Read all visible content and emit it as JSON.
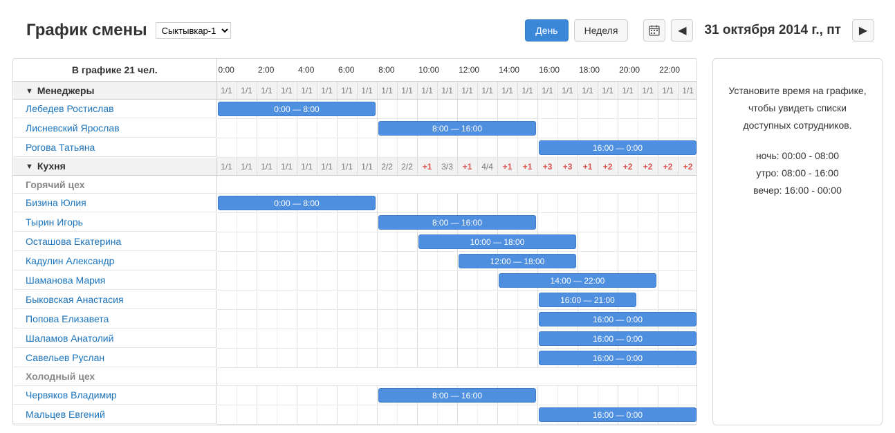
{
  "header": {
    "title": "График смены",
    "location": "Сыктывкар-1",
    "day_btn": "День",
    "week_btn": "Неделя",
    "date": "31 октября 2014 г., пт"
  },
  "side": {
    "hint": "Установите время на графике, чтобы увидеть списки доступных сотрудников.",
    "night": "ночь: 00:00 - 08:00",
    "morning": "утро: 08:00 - 16:00",
    "evening": "вечер: 16:00 - 00:00"
  },
  "top": {
    "count_label": "В графике 21 чел.",
    "hours": [
      "0:00",
      "",
      "2:00",
      "",
      "4:00",
      "",
      "6:00",
      "",
      "8:00",
      "",
      "10:00",
      "",
      "12:00",
      "",
      "14:00",
      "",
      "16:00",
      "",
      "18:00",
      "",
      "20:00",
      "",
      "22:00",
      ""
    ]
  },
  "groups": [
    {
      "name": "Менеджеры",
      "collapsible": true,
      "hours": [
        {
          "v": "1/1"
        },
        {
          "v": "1/1"
        },
        {
          "v": "1/1"
        },
        {
          "v": "1/1"
        },
        {
          "v": "1/1"
        },
        {
          "v": "1/1"
        },
        {
          "v": "1/1"
        },
        {
          "v": "1/1"
        },
        {
          "v": "1/1"
        },
        {
          "v": "1/1"
        },
        {
          "v": "1/1"
        },
        {
          "v": "1/1"
        },
        {
          "v": "1/1"
        },
        {
          "v": "1/1"
        },
        {
          "v": "1/1"
        },
        {
          "v": "1/1"
        },
        {
          "v": "1/1"
        },
        {
          "v": "1/1"
        },
        {
          "v": "1/1"
        },
        {
          "v": "1/1"
        },
        {
          "v": "1/1"
        },
        {
          "v": "1/1"
        },
        {
          "v": "1/1"
        },
        {
          "v": "1/1"
        }
      ],
      "rows": [
        {
          "name": "Лебедев Ростислав",
          "start": 0,
          "end": 8,
          "label": "0:00 — 8:00"
        },
        {
          "name": "Лисневский Ярослав",
          "start": 8,
          "end": 16,
          "label": "8:00 — 16:00"
        },
        {
          "name": "Рогова Татьяна",
          "start": 16,
          "end": 24,
          "label": "16:00 — 0:00"
        }
      ]
    },
    {
      "name": "Кухня",
      "collapsible": true,
      "hours": [
        {
          "v": "1/1"
        },
        {
          "v": "1/1"
        },
        {
          "v": "1/1"
        },
        {
          "v": "1/1"
        },
        {
          "v": "1/1"
        },
        {
          "v": "1/1"
        },
        {
          "v": "1/1"
        },
        {
          "v": "1/1"
        },
        {
          "v": "2/2"
        },
        {
          "v": "2/2"
        },
        {
          "v": "+1",
          "red": true
        },
        {
          "v": "3/3"
        },
        {
          "v": "+1",
          "red": true
        },
        {
          "v": "4/4"
        },
        {
          "v": "+1",
          "red": true
        },
        {
          "v": "+1",
          "red": true
        },
        {
          "v": "+3",
          "red": true
        },
        {
          "v": "+3",
          "red": true
        },
        {
          "v": "+1",
          "red": true
        },
        {
          "v": "+2",
          "red": true
        },
        {
          "v": "+2",
          "red": true
        },
        {
          "v": "+2",
          "red": true
        },
        {
          "v": "+2",
          "red": true
        },
        {
          "v": "+2",
          "red": true
        }
      ],
      "subgroups": [
        {
          "name": "Горячий цех",
          "rows": [
            {
              "name": "Бизина Юлия",
              "start": 0,
              "end": 8,
              "label": "0:00 — 8:00"
            },
            {
              "name": "Тырин Игорь",
              "start": 8,
              "end": 16,
              "label": "8:00 — 16:00"
            },
            {
              "name": "Осташова Екатерина",
              "start": 10,
              "end": 18,
              "label": "10:00 — 18:00"
            },
            {
              "name": "Кадулин Александр",
              "start": 12,
              "end": 18,
              "label": "12:00 — 18:00"
            },
            {
              "name": "Шаманова Мария",
              "start": 14,
              "end": 22,
              "label": "14:00 — 22:00"
            },
            {
              "name": "Быковская Анастасия",
              "start": 16,
              "end": 21,
              "label": "16:00 — 21:00"
            },
            {
              "name": "Попова Елизавета",
              "start": 16,
              "end": 24,
              "label": "16:00 — 0:00"
            },
            {
              "name": "Шаламов Анатолий",
              "start": 16,
              "end": 24,
              "label": "16:00 — 0:00"
            },
            {
              "name": "Савельев Руслан",
              "start": 16,
              "end": 24,
              "label": "16:00 — 0:00"
            }
          ]
        },
        {
          "name": "Холодный цех",
          "rows": [
            {
              "name": "Червяков Владимир",
              "start": 8,
              "end": 16,
              "label": "8:00 — 16:00"
            },
            {
              "name": "Мальцев Евгений",
              "start": 16,
              "end": 24,
              "label": "16:00 — 0:00"
            }
          ]
        }
      ]
    }
  ]
}
